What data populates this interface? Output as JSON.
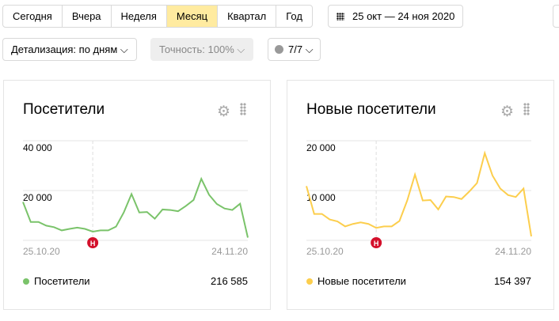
{
  "periods": [
    "Сегодня",
    "Вчера",
    "Неделя",
    "Месяц",
    "Квартал",
    "Год"
  ],
  "active_period": 3,
  "date_range": "25 окт — 24 ноя 2020",
  "detail": "Детализация: по дням",
  "accuracy": "Точность: 100%",
  "notes": "7/7",
  "cards": [
    {
      "title": "Посетители",
      "legend": "Посетители",
      "total": "216 585",
      "color": "#7ac36a",
      "chart_data": {
        "type": "line",
        "x_start": "25.10.20",
        "x_end": "24.11.20",
        "y_ticks": [
          "20 000",
          "40 000"
        ],
        "ylim": [
          0,
          40000
        ],
        "values": [
          15400,
          7400,
          7400,
          5900,
          5300,
          4000,
          4600,
          5100,
          4600,
          3500,
          4000,
          4000,
          5500,
          11200,
          18600,
          11200,
          11400,
          8700,
          12400,
          12200,
          11700,
          13800,
          16200,
          24700,
          18300,
          14600,
          12800,
          12200,
          14700,
          1100
        ]
      }
    },
    {
      "title": "Новые посетители",
      "legend": "Новые посетители",
      "total": "154 397",
      "color": "#fcce4d",
      "chart_data": {
        "type": "line",
        "x_start": "25.10.20",
        "x_end": "24.11.20",
        "y_ticks": [
          "10 000",
          "20 000"
        ],
        "ylim": [
          0,
          20000
        ],
        "values": [
          10900,
          5300,
          5300,
          4200,
          3800,
          2800,
          3300,
          3600,
          3300,
          2500,
          2800,
          2800,
          3900,
          8000,
          13200,
          8000,
          8100,
          6200,
          8800,
          8700,
          8300,
          9800,
          11500,
          17500,
          13000,
          10400,
          9100,
          8700,
          10400,
          800
        ]
      }
    }
  ],
  "marker_label": "Н"
}
